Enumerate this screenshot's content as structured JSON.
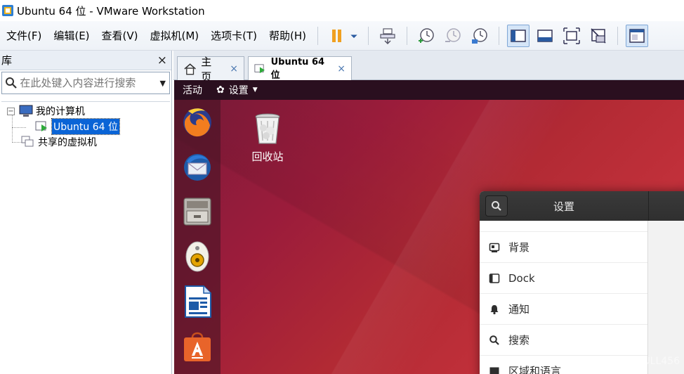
{
  "window": {
    "title": "Ubuntu 64 位 - VMware Workstation"
  },
  "menu": {
    "items": [
      "文件(F)",
      "编辑(E)",
      "查看(V)",
      "虚拟机(M)",
      "选项卡(T)",
      "帮助(H)"
    ]
  },
  "library": {
    "title": "库",
    "close": "×",
    "search_placeholder": "在此处键入内容进行搜索",
    "tree": {
      "my_computer": "我的计算机",
      "vm": "Ubuntu 64 位",
      "shared": "共享的虚拟机"
    }
  },
  "tabs": [
    {
      "label": "主页",
      "close": "×"
    },
    {
      "label": "Ubuntu 64 位",
      "close": "×"
    }
  ],
  "guest": {
    "topbar": {
      "activities": "活动",
      "app_menu": "设置"
    },
    "desktop": {
      "trash_label": "回收站"
    },
    "settings_window": {
      "title": "设置",
      "items": [
        "背景",
        "Dock",
        "通知",
        "搜索",
        "区域和语言"
      ]
    },
    "watermark": "https://blog.csdn.net/NULL456"
  },
  "colors": {
    "selection": "#0a64d6",
    "ubuntu_bg": "#a21c3a",
    "topbar": "#2a0f1f"
  }
}
